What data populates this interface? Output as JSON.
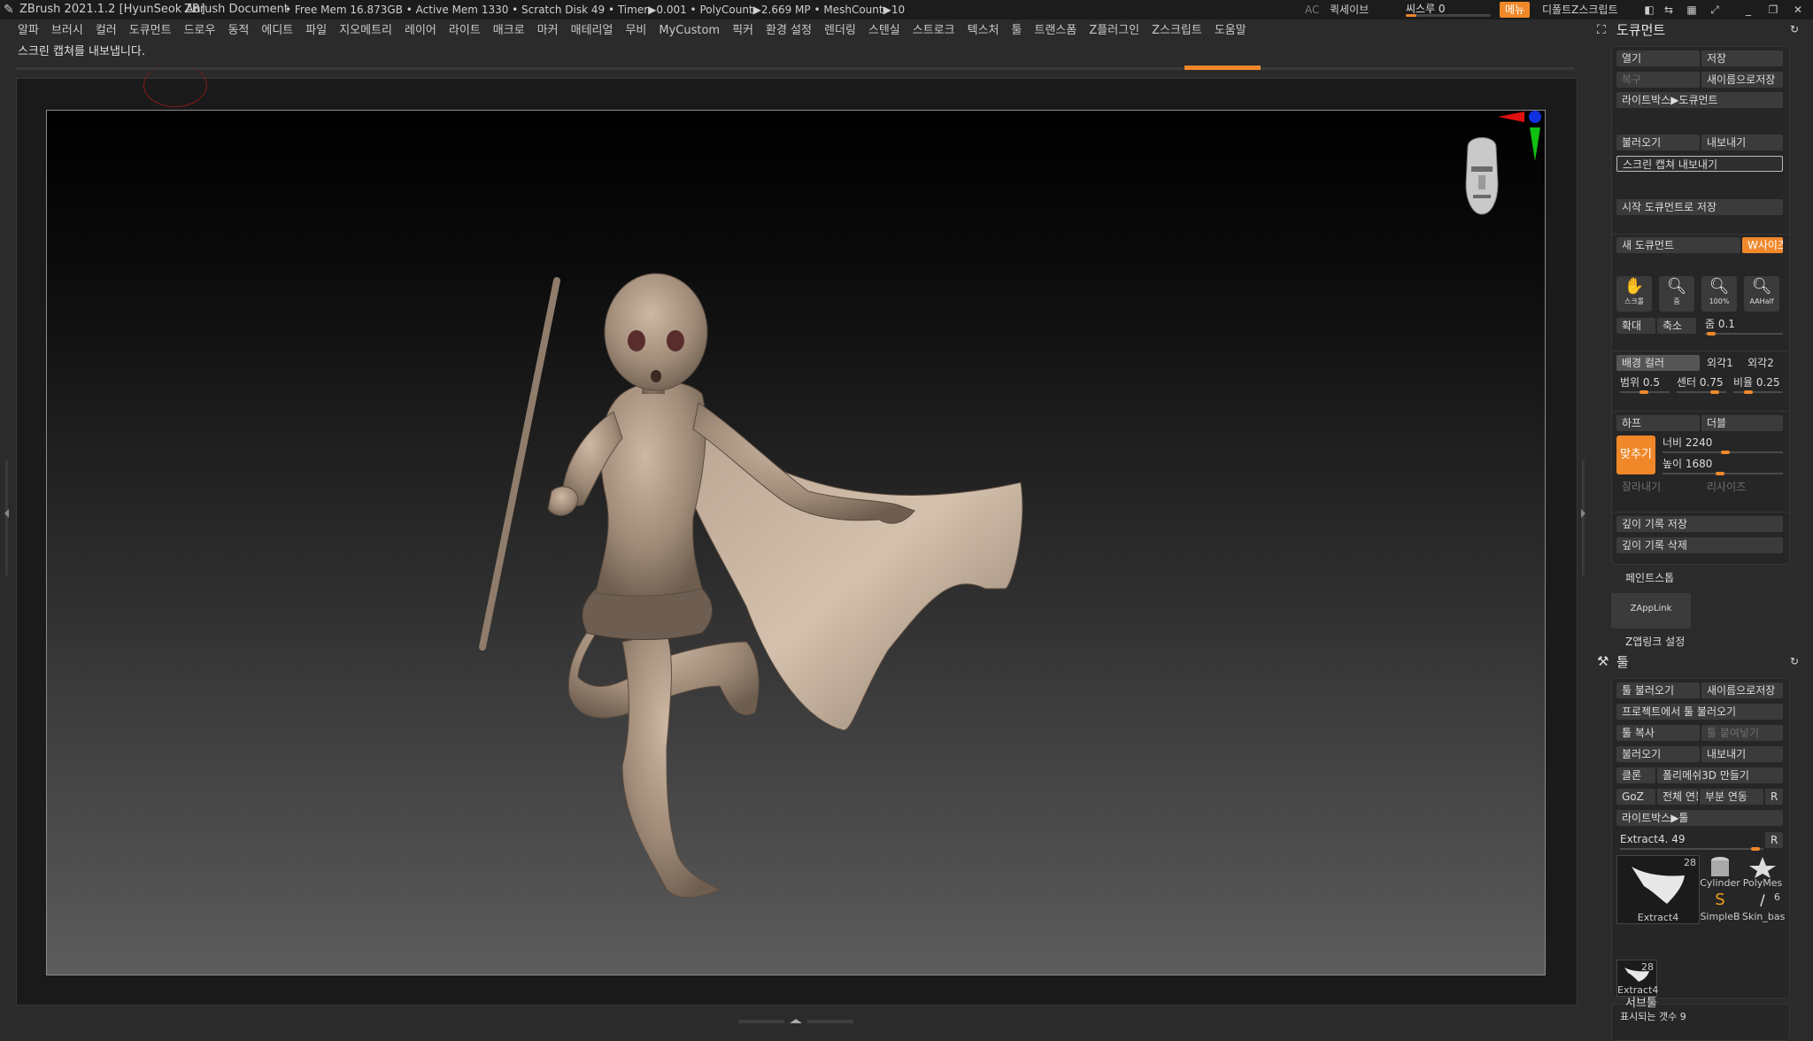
{
  "titlebar": {
    "app": "ZBrush 2021.1.2 [HyunSeok An]",
    "doc": "ZBrush Document",
    "stats": "• Free Mem 16.873GB • Active Mem 1330 • Scratch Disk 49 • Timer▶0.001 • PolyCount▶2.669 MP • MeshCount▶10",
    "ac": "AC",
    "quicksave": "퀵세이브",
    "seethrough_label": "씨스루 0",
    "seethrough_value": 0.1,
    "menu_btn": "메뉴",
    "default_script": "디폴트Z스크립트"
  },
  "menubar": [
    "알파",
    "브러시",
    "컬러",
    "도큐먼트",
    "드로우",
    "동적",
    "에디트",
    "파일",
    "지오메트리",
    "레이어",
    "라이트",
    "매크로",
    "마커",
    "매테리얼",
    "무비",
    "MyCustom",
    "픽커",
    "환경 설정",
    "렌더링",
    "스텐실",
    "스트로크",
    "텍스처",
    "툴",
    "트랜스폼",
    "Z플러그인",
    "Z스크립트",
    "도움말"
  ],
  "status": "스크린 캡쳐를 내보냅니다.",
  "document": {
    "title": "도큐먼트",
    "open": "열기",
    "save": "저장",
    "revert": "복구",
    "save_as": "새이름으로저장",
    "lightbox_doc": "라이트박스▶도큐먼트",
    "import": "불러오기",
    "export": "내보내기",
    "export_screen": "스크린 캡쳐 내보내기",
    "save_startup": "시작 도큐먼트로 저장",
    "new_doc": "새 도큐먼트",
    "wsize": "W사이즈",
    "icons": [
      {
        "name": "scroll",
        "label": "스크롤"
      },
      {
        "name": "zoom",
        "label": "줌"
      },
      {
        "name": "actual",
        "label": "100%"
      },
      {
        "name": "aahalf",
        "label": "AAHalf"
      }
    ],
    "zoom_in": "확대",
    "zoom_out": "축소",
    "zoom_label": "줌 0.1",
    "zoom_value": 0.1,
    "back_color": "배경 컬러",
    "border1": "외각1",
    "border2": "외각2",
    "range_label": "범위 0.5",
    "center_label": "센터 0.75",
    "rate_label": "비율 0.25",
    "half": "하프",
    "double": "더블",
    "crop": "맞추기",
    "width_label": "너비 2240",
    "height_label": "높이 1680",
    "cut": "잘라내기",
    "resize": "리사이즈",
    "store_depth": "깊이 기록 저장",
    "delete_depth": "깊이 기록 삭제",
    "paint_stop": "페인트스톱",
    "zapplink": "ZAppLink",
    "zapplink_settings": "Z앱링크 설정"
  },
  "tool": {
    "title": "툴",
    "load_tool": "툴 불러오기",
    "save_as": "새이름으로저장",
    "load_project": "프로젝트에서 툴 불러오기",
    "copy_tool": "툴 복사",
    "paste_tool": "툴 붙여넣기",
    "import": "불러오기",
    "export": "내보내기",
    "clone": "클론",
    "make_polymesh": "폴리메쉬3D 만들기",
    "goz": "GoZ",
    "all": "전체 연동",
    "visible": "부분 연동",
    "r": "R",
    "lightbox_tool": "라이트박스▶툴",
    "current_label": "Extract4. 49",
    "current_value": 0.9,
    "main_thumb": {
      "caption": "Extract4",
      "count": "28"
    },
    "thumbs": [
      {
        "caption": "Cylinder",
        "icon": "cylinder-icon"
      },
      {
        "caption": "PolyMes",
        "icon": "polymesh-star-icon"
      },
      {
        "caption": "SimpleB",
        "icon": "simplebrush-icon"
      },
      {
        "caption": "Skin_bas",
        "icon": "skin-icon",
        "count": "6"
      }
    ],
    "small_thumb": {
      "caption": "Extract4",
      "count": "28"
    },
    "subtool": "서브툴",
    "visible_count": "표시되는 갯수 9"
  },
  "colors": {
    "accent": "#f0882a",
    "panel": "#2b2b2b"
  }
}
